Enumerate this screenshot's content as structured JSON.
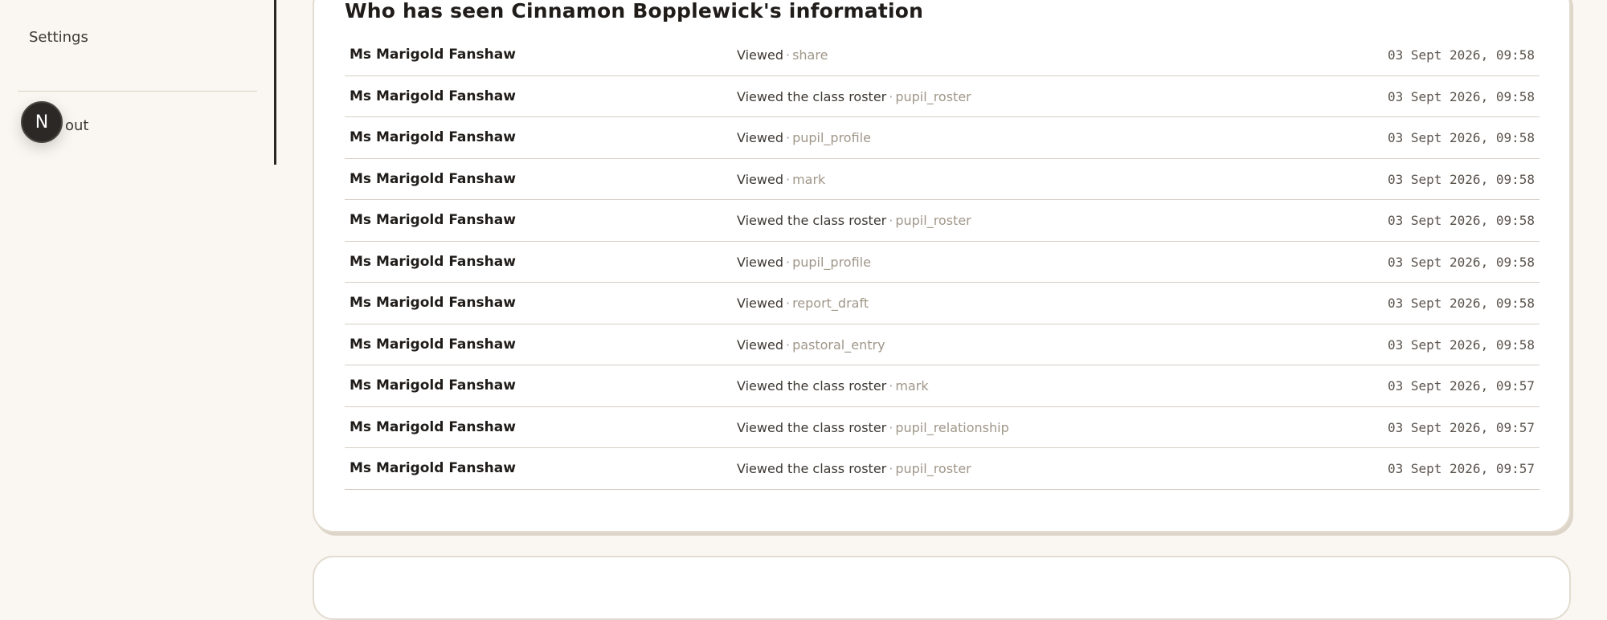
{
  "sidebar": {
    "settings_label": "Settings",
    "signout_label": "Sign out",
    "avatar_initial": "N"
  },
  "card": {
    "title": "Who has seen Cinnamon Bopplewick's information"
  },
  "access_log": [
    {
      "who": "Ms Marigold Fanshaw",
      "action": "Viewed",
      "sep": "·",
      "resource": "share",
      "when": "03 Sept 2026, 09:58"
    },
    {
      "who": "Ms Marigold Fanshaw",
      "action": "Viewed the class roster",
      "sep": "·",
      "resource": "pupil_roster",
      "when": "03 Sept 2026, 09:58"
    },
    {
      "who": "Ms Marigold Fanshaw",
      "action": "Viewed",
      "sep": "·",
      "resource": "pupil_profile",
      "when": "03 Sept 2026, 09:58"
    },
    {
      "who": "Ms Marigold Fanshaw",
      "action": "Viewed",
      "sep": "·",
      "resource": "mark",
      "when": "03 Sept 2026, 09:58"
    },
    {
      "who": "Ms Marigold Fanshaw",
      "action": "Viewed the class roster",
      "sep": "·",
      "resource": "pupil_roster",
      "when": "03 Sept 2026, 09:58"
    },
    {
      "who": "Ms Marigold Fanshaw",
      "action": "Viewed",
      "sep": "·",
      "resource": "pupil_profile",
      "when": "03 Sept 2026, 09:58"
    },
    {
      "who": "Ms Marigold Fanshaw",
      "action": "Viewed",
      "sep": "·",
      "resource": "report_draft",
      "when": "03 Sept 2026, 09:58"
    },
    {
      "who": "Ms Marigold Fanshaw",
      "action": "Viewed",
      "sep": "·",
      "resource": "pastoral_entry",
      "when": "03 Sept 2026, 09:58"
    },
    {
      "who": "Ms Marigold Fanshaw",
      "action": "Viewed the class roster",
      "sep": "·",
      "resource": "mark",
      "when": "03 Sept 2026, 09:57"
    },
    {
      "who": "Ms Marigold Fanshaw",
      "action": "Viewed the class roster",
      "sep": "·",
      "resource": "pupil_relationship",
      "when": "03 Sept 2026, 09:57"
    },
    {
      "who": "Ms Marigold Fanshaw",
      "action": "Viewed the class roster",
      "sep": "·",
      "resource": "pupil_roster",
      "when": "03 Sept 2026, 09:57"
    }
  ]
}
